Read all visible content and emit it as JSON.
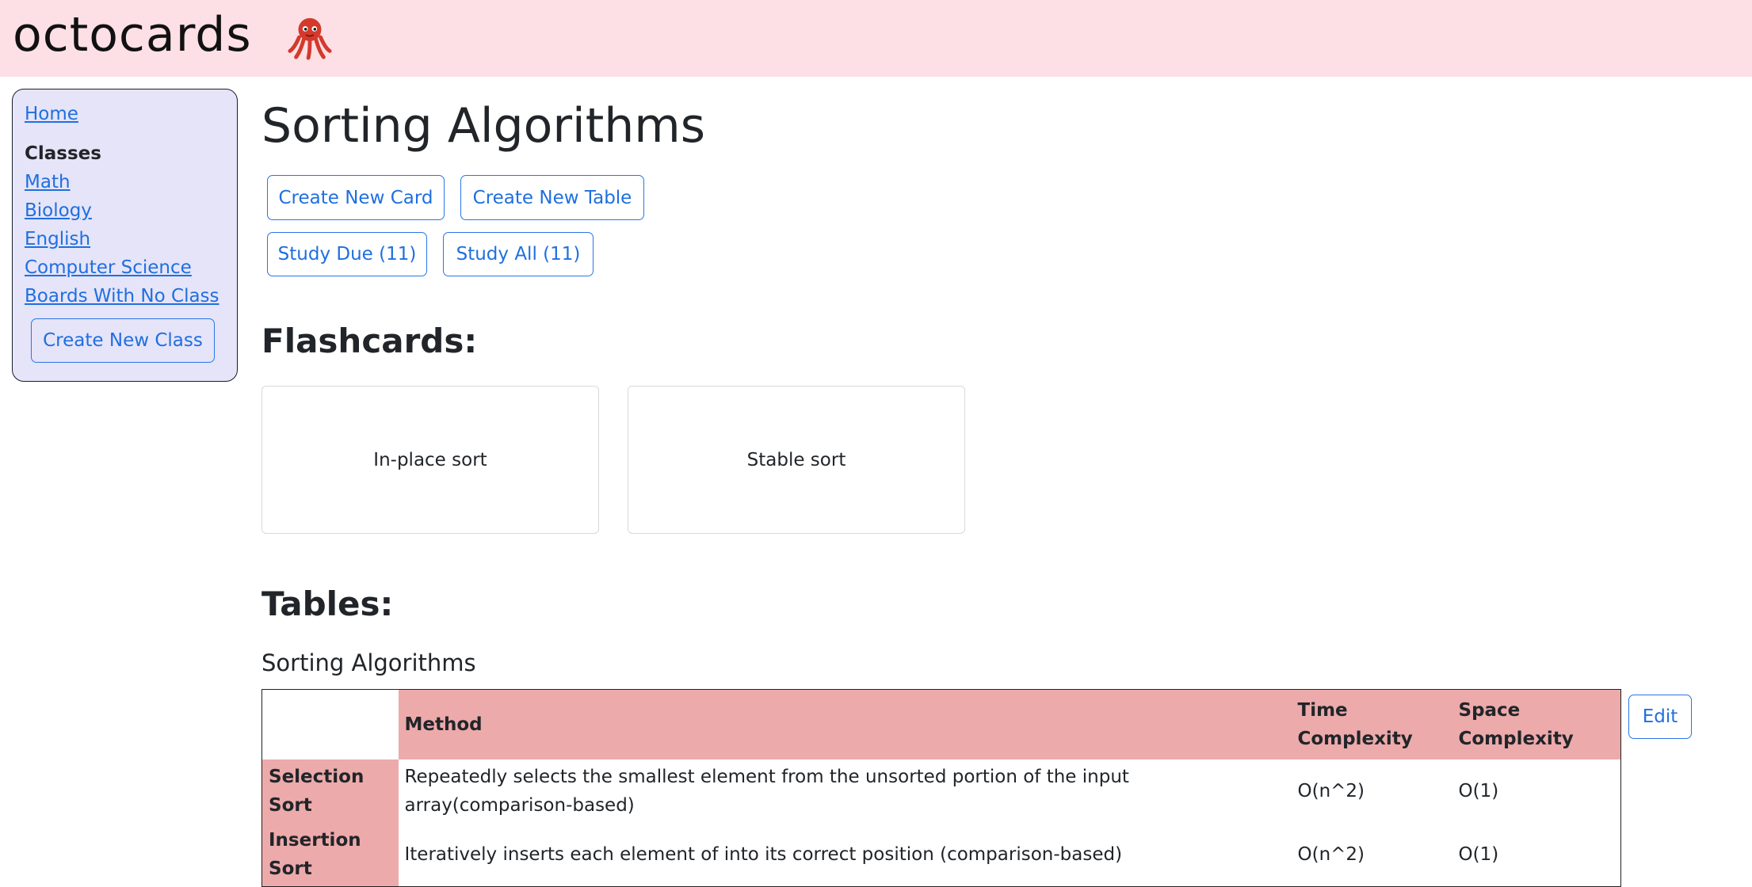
{
  "header": {
    "logo_text": "octocards",
    "logo_icon": "octopus-icon",
    "accent_color": "#fde0e5"
  },
  "sidebar": {
    "home_label": "Home",
    "classes_heading": "Classes",
    "classes": [
      "Math",
      "Biology",
      "English",
      "Computer Science",
      "Boards With No Class"
    ],
    "create_class_label": "Create New Class",
    "background_color": "#e5e4f8"
  },
  "main": {
    "title": "Sorting Algorithms",
    "buttons": {
      "create_card": "Create New Card",
      "create_table": "Create New Table",
      "study_due": "Study Due (11)",
      "study_all": "Study All (11)"
    },
    "flashcards_heading": "Flashcards:",
    "flashcards": [
      "In-place sort",
      "Stable sort"
    ],
    "tables_heading": "Tables:",
    "table": {
      "title": "Sorting Algorithms",
      "edit_label": "Edit",
      "header_color": "#edaaab",
      "columns": [
        "",
        "Method",
        "Time Complexity",
        "Space Complexity"
      ],
      "rows": [
        {
          "name": "Selection Sort",
          "method": "Repeatedly selects the smallest element from the unsorted portion of the input array(comparison-based)",
          "time": "O(n^2)",
          "space": "O(1)"
        },
        {
          "name": "Insertion Sort",
          "method": "Iteratively inserts each element of into its correct position (comparison-based)",
          "time": "O(n^2)",
          "space": "O(1)"
        }
      ]
    }
  }
}
